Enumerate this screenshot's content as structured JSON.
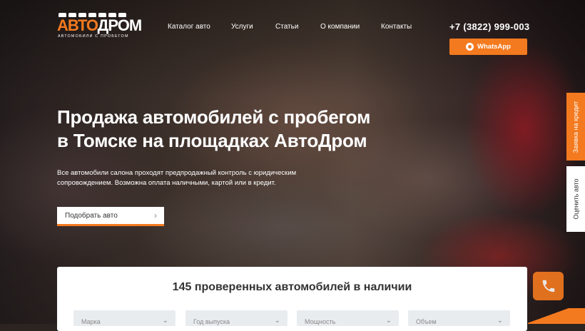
{
  "brand": {
    "logo_word_accent": "АВТО",
    "logo_word_rest": "ДРОМ",
    "logo_tagline": "АВТОМОБИЛИ С ПРОБЕГОМ",
    "accent_color": "#f47a1f"
  },
  "nav": {
    "items": [
      {
        "label": "Каталог авто"
      },
      {
        "label": "Услуги"
      },
      {
        "label": "Статьи"
      },
      {
        "label": "О компании"
      },
      {
        "label": "Контакты"
      }
    ]
  },
  "contact": {
    "phone": "+7 (3822) 999-003",
    "whatsapp_label": "WhatsApp",
    "whatsapp_icon": "whatsapp-icon"
  },
  "hero": {
    "title_line1": "Продажа автомобилей с пробегом",
    "title_line2": "в Томске на площадках АвтоДром",
    "desc_line1": "Все автомобили салона проходят предпродажный контроль с юридическим",
    "desc_line2": "сопровождением. Возможна оплата наличными, картой или в кредит.",
    "cta_label": "Подобрать авто",
    "cta_icon": "chevron-right-icon"
  },
  "side_tabs": {
    "credit": "Заявка на кредит",
    "rate": "Оценить авто"
  },
  "call_button": {
    "icon": "phone-icon"
  },
  "search_panel": {
    "title": "145 проверенных автомобилей в наличии",
    "filters": [
      {
        "placeholder": "Марка"
      },
      {
        "placeholder": "Год выпуска"
      },
      {
        "placeholder": "Мощность"
      },
      {
        "placeholder": "Объем"
      }
    ]
  }
}
